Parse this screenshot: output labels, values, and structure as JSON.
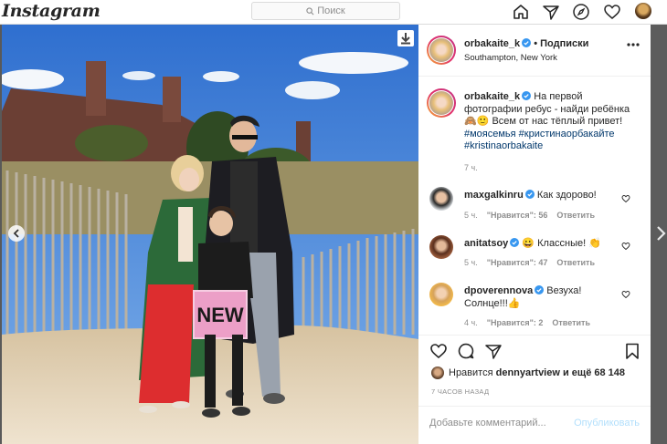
{
  "topbar": {
    "logo": "Instagram",
    "search_placeholder": "Поиск",
    "icons": [
      "home-icon",
      "direct-icon",
      "explore-icon",
      "activity-heart-icon",
      "profile-avatar"
    ]
  },
  "post": {
    "author": "orbakaite_k",
    "follow_label": "• Подписки",
    "location": "Southampton, New York",
    "caption_lines": [
      "На первой",
      "фотографии ребус - найди ребёнка",
      "🙈🙂 Всем от нас тёплый привет!"
    ],
    "tags_line1": "#моясемья #кристинаорбакайте",
    "tags_line2": "#kristinaorbakaite",
    "caption_time": "7 ч.",
    "comments": [
      {
        "user": "maxgalkinru",
        "text": "Как здорово!",
        "time": "5 ч.",
        "likes": "\"Нравится\": 56",
        "reply": "Ответить"
      },
      {
        "user": "anitatsoy",
        "text": "😀 Классные! 👏",
        "time": "5 ч.",
        "likes": "\"Нравится\": 47",
        "reply": "Ответить"
      },
      {
        "user": "dpoverennova",
        "text_line1": "Везуха!",
        "text_line2": "Солнце!!!👍",
        "time": "4 ч.",
        "likes": "\"Нравится\": 2",
        "reply": "Ответить"
      }
    ],
    "liked_by_prefix": "Нравится",
    "liked_by_user": "dennyartview",
    "liked_by_suffix": "и ещё 68 148",
    "posted_ago": "7 ЧАСОВ НАЗАД",
    "add_comment_placeholder": "Добавьте комментарий...",
    "publish_label": "Опубликовать"
  },
  "photo": {
    "sign_text": "NEW"
  },
  "colors": {
    "verified": "#3897f0",
    "hashtag": "#00376b",
    "publish_disabled": "#b2dffc",
    "meta": "#8e8e8e"
  }
}
